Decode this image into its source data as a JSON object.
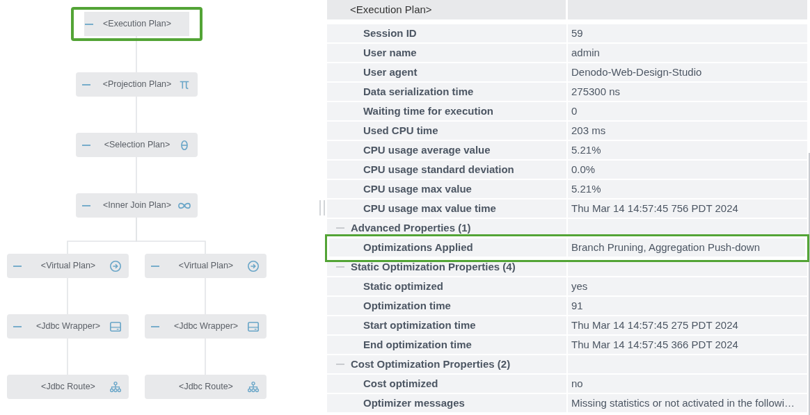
{
  "plan_tree": {
    "root": {
      "label": "<Execution Plan>",
      "expanded": true,
      "highlighted": true,
      "children": [
        {
          "label": "<Projection Plan>",
          "kind": "pi",
          "expanded": true,
          "highlighted": false,
          "children": [
            {
              "label": "<Selection Plan>",
              "kind": "theta",
              "expanded": true,
              "highlighted": false,
              "children": [
                {
                  "label": "<Inner Join Plan>",
                  "kind": "infinity",
                  "expanded": true,
                  "highlighted": false,
                  "children": [
                    {
                      "label": "<Virtual Plan>",
                      "kind": "arrow",
                      "expanded": true,
                      "highlighted": false,
                      "children": [
                        {
                          "label": "<Jdbc Wrapper>",
                          "kind": "wrapper",
                          "expanded": true,
                          "highlighted": false,
                          "children": [
                            {
                              "label": "<Jdbc Route>",
                              "kind": "route",
                              "highlighted": false
                            }
                          ]
                        }
                      ]
                    },
                    {
                      "label": "<Virtual Plan>",
                      "kind": "arrow",
                      "expanded": true,
                      "highlighted": false,
                      "children": [
                        {
                          "label": "<Jdbc Wrapper>",
                          "kind": "wrapper",
                          "expanded": true,
                          "highlighted": false,
                          "children": [
                            {
                              "label": "<Jdbc Route>",
                              "kind": "route",
                              "highlighted": false
                            }
                          ]
                        }
                      ]
                    }
                  ]
                }
              ]
            }
          ]
        }
      ]
    }
  },
  "properties": {
    "header": "<Execution Plan>",
    "rows": [
      {
        "kind": "property",
        "name": "Session ID",
        "value": "59",
        "highlighted": false
      },
      {
        "kind": "property",
        "name": "User name",
        "value": "admin",
        "highlighted": false
      },
      {
        "kind": "property",
        "name": "User agent",
        "value": "Denodo-Web-Design-Studio",
        "highlighted": false
      },
      {
        "kind": "property",
        "name": "Data serialization time",
        "value": "275300 ns",
        "highlighted": false
      },
      {
        "kind": "property",
        "name": "Waiting time for execution",
        "value": "0",
        "highlighted": false
      },
      {
        "kind": "property",
        "name": "Used CPU time",
        "value": "203 ms",
        "highlighted": false
      },
      {
        "kind": "property",
        "name": "CPU usage average value",
        "value": "5.21%",
        "highlighted": false
      },
      {
        "kind": "property",
        "name": "CPU usage standard deviation",
        "value": "0.0%",
        "highlighted": false
      },
      {
        "kind": "property",
        "name": "CPU usage max value",
        "value": "5.21%",
        "highlighted": false
      },
      {
        "kind": "property",
        "name": "CPU usage max value time",
        "value": "Thu Mar 14 14:57:45 756 PDT 2024",
        "highlighted": false
      },
      {
        "kind": "group",
        "name": "Advanced Properties (1)",
        "expanded": true
      },
      {
        "kind": "property",
        "name": "Optimizations Applied",
        "value": "Branch Pruning, Aggregation Push-down",
        "highlighted": true
      },
      {
        "kind": "group",
        "name": "Static Optimization Properties (4)",
        "expanded": true
      },
      {
        "kind": "property",
        "name": "Static optimized",
        "value": "yes",
        "highlighted": false
      },
      {
        "kind": "property",
        "name": "Optimization time",
        "value": "91",
        "highlighted": false
      },
      {
        "kind": "property",
        "name": "Start optimization time",
        "value": "Thu Mar 14 14:57:45 275 PDT 2024",
        "highlighted": false
      },
      {
        "kind": "property",
        "name": "End optimization time",
        "value": "Thu Mar 14 14:57:45 366 PDT 2024",
        "highlighted": false
      },
      {
        "kind": "group",
        "name": "Cost Optimization Properties (2)",
        "expanded": true
      },
      {
        "kind": "property",
        "name": "Cost optimized",
        "value": "no",
        "highlighted": false
      },
      {
        "kind": "property",
        "name": "Optimizer messages",
        "value": "Missing statistics or not activated in the followi…",
        "highlighted": false
      }
    ]
  }
}
